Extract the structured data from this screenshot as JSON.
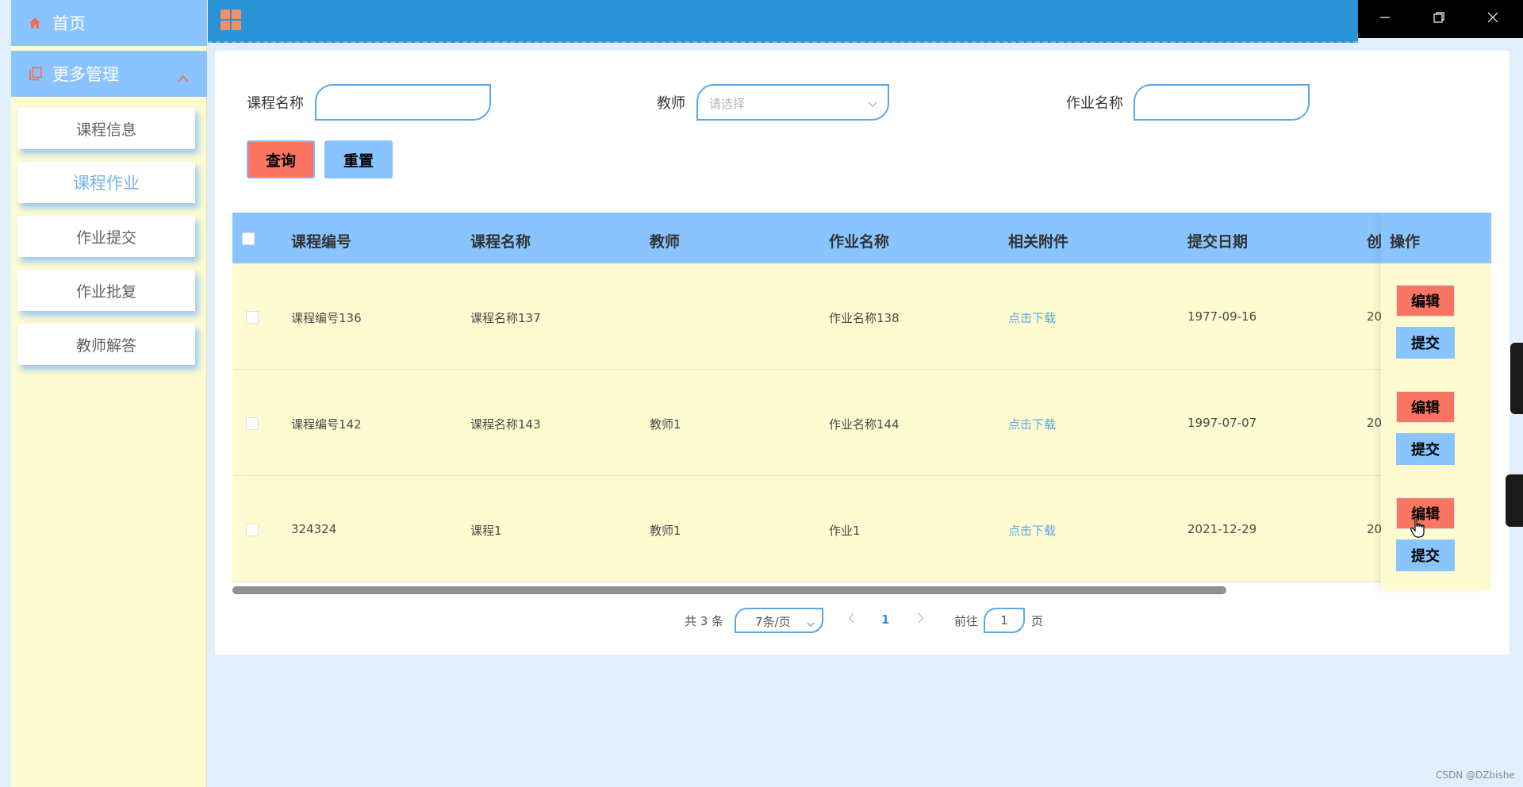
{
  "sidebar": {
    "home_label": "首页",
    "more_label": "更多管理",
    "items": [
      {
        "label": "课程信息"
      },
      {
        "label": "课程作业"
      },
      {
        "label": "作业提交"
      },
      {
        "label": "作业批复"
      },
      {
        "label": "教师解答"
      }
    ],
    "active_item": "课程作业",
    "icons": {
      "home": "home-icon",
      "more": "copy-icon",
      "collapse": "chevron-up-icon"
    }
  },
  "topbar": {
    "icon": "grid-menu-icon"
  },
  "window_controls": {
    "icons": [
      "minimize-icon",
      "restore-icon",
      "close-icon"
    ]
  },
  "search": {
    "course_name_label": "课程名称",
    "course_name_value": "",
    "teacher_label": "教师",
    "teacher_placeholder": "请选择",
    "homework_name_label": "作业名称",
    "homework_name_value": "",
    "query_button": "查询",
    "reset_button": "重置"
  },
  "table": {
    "columns": [
      "课程编号",
      "课程名称",
      "教师",
      "作业名称",
      "相关附件",
      "提交日期",
      "创",
      "操作"
    ],
    "rows": [
      {
        "course_no": "课程编号136",
        "course_name": "课程名称137",
        "teacher": "",
        "homework": "作业名称138",
        "attachment": "点击下载",
        "date": "1977-09-16",
        "created": "20",
        "edit": "编辑",
        "submit": "提交"
      },
      {
        "course_no": "课程编号142",
        "course_name": "课程名称143",
        "teacher": "教师1",
        "homework": "作业名称144",
        "attachment": "点击下载",
        "date": "1997-07-07",
        "created": "20",
        "edit": "编辑",
        "submit": "提交"
      },
      {
        "course_no": "324324",
        "course_name": "课程1",
        "teacher": "教师1",
        "homework": "作业1",
        "attachment": "点击下载",
        "date": "2021-12-29",
        "created": "20",
        "edit": "编辑",
        "submit": "提交"
      }
    ]
  },
  "pagination": {
    "total": "共 3 条",
    "page_size": "7条/页",
    "current_page": "1",
    "goto_label": "前往",
    "goto_value": "1",
    "page_suffix": "页"
  },
  "watermark": "CSDN @DZbishe",
  "colors": {
    "sidebar_bg": "#fefbd0",
    "nav_blue": "#8ac4fe",
    "topbar": "#2a93d6",
    "danger": "#fb7662",
    "link": "#5aa6e8"
  }
}
